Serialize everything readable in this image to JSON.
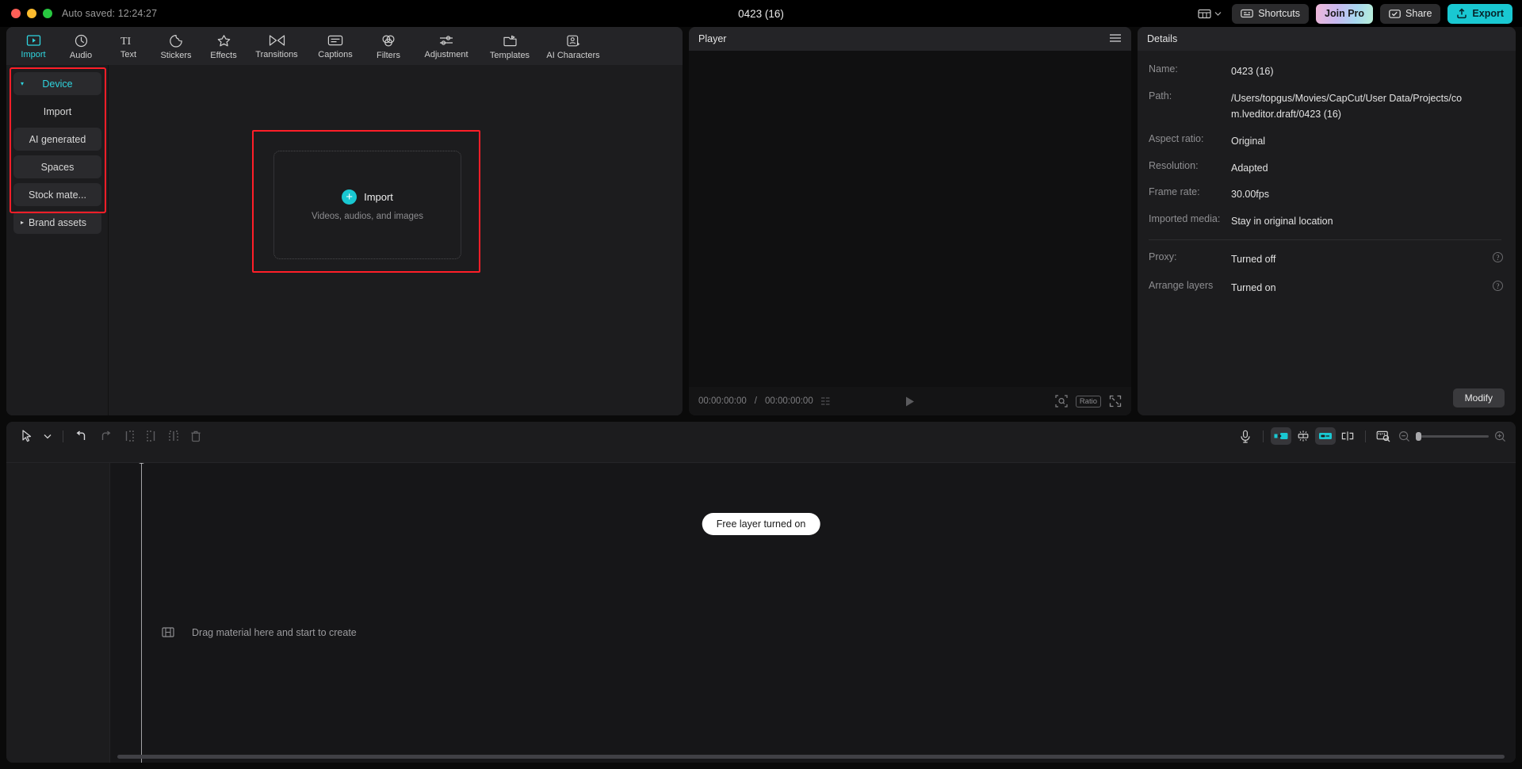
{
  "titlebar": {
    "autosave": "Auto saved: 12:24:27",
    "project_title": "0423 (16)",
    "layout_icon": "layout-icon",
    "chevron_icon": "chevron-down-icon",
    "buttons": [
      {
        "label": "Shortcuts",
        "icon": "keyboard-icon",
        "style": "default"
      },
      {
        "label": "Join Pro",
        "icon": "",
        "style": "join"
      },
      {
        "label": "Share",
        "icon": "share-icon",
        "style": "default"
      },
      {
        "label": "Export",
        "icon": "export-icon",
        "style": "export"
      }
    ]
  },
  "nav_tabs": [
    {
      "label": "Import",
      "icon": "media-play-icon",
      "active": true
    },
    {
      "label": "Audio",
      "icon": "audio-note-icon",
      "active": false
    },
    {
      "label": "Text",
      "icon": "text-ti-icon",
      "active": false
    },
    {
      "label": "Stickers",
      "icon": "sticker-icon",
      "active": false
    },
    {
      "label": "Effects",
      "icon": "effects-star-icon",
      "active": false
    },
    {
      "label": "Transitions",
      "icon": "transitions-icon",
      "active": false
    },
    {
      "label": "Captions",
      "icon": "captions-icon",
      "active": false
    },
    {
      "label": "Filters",
      "icon": "filters-icon",
      "active": false
    },
    {
      "label": "Adjustment",
      "icon": "adjustment-sliders-icon",
      "active": false
    },
    {
      "label": "Templates",
      "icon": "templates-folder-icon",
      "active": false
    },
    {
      "label": "AI Characters",
      "icon": "ai-character-icon",
      "active": false
    }
  ],
  "categories": [
    {
      "label": "Device",
      "active": true,
      "caret": "▾",
      "filled": true
    },
    {
      "label": "Import",
      "active": false,
      "caret": "",
      "filled": false
    },
    {
      "label": "AI generated",
      "active": false,
      "caret": "",
      "filled": true
    },
    {
      "label": "Spaces",
      "active": false,
      "caret": "",
      "filled": true
    },
    {
      "label": "Stock mate...",
      "active": false,
      "caret": "",
      "filled": true
    },
    {
      "label": "Brand assets",
      "active": false,
      "caret": "▸",
      "filled": true
    }
  ],
  "dropzone": {
    "label": "Import",
    "sublabel": "Videos, audios, and images",
    "plus_icon": "plus-circle-icon"
  },
  "player": {
    "title": "Player",
    "menu_icon": "hamburger-icon",
    "current_time": "00:00:00:00",
    "total_time": "00:00:00:00",
    "separator": "/",
    "play_icon": "play-icon",
    "frames_icon": "frames-icon",
    "zoom_icon": "zoom-fit-icon",
    "ratio_label": "Ratio",
    "fullscreen_icon": "fullscreen-icon"
  },
  "details": {
    "title": "Details",
    "rows": [
      {
        "label": "Name:",
        "value": "0423 (16)"
      },
      {
        "label": "Path:",
        "value": "/Users/topgus/Movies/CapCut/User Data/Projects/com.lveditor.draft/0423 (16)"
      },
      {
        "label": "Aspect ratio:",
        "value": "Original"
      },
      {
        "label": "Resolution:",
        "value": "Adapted"
      },
      {
        "label": "Frame rate:",
        "value": "30.00fps"
      },
      {
        "label": "Imported media:",
        "value": "Stay in original location"
      }
    ],
    "toggle_rows": [
      {
        "label": "Proxy:",
        "value": "Turned off",
        "help_icon": "help-circle-icon"
      },
      {
        "label": "Arrange layers",
        "value": "Turned on",
        "help_icon": "help-circle-icon"
      }
    ],
    "modify_label": "Modify"
  },
  "timeline": {
    "tools": [
      {
        "name": "select-cursor-tool",
        "icon": "cursor-arrow-icon",
        "dim": false
      },
      {
        "name": "tool-dropdown",
        "icon": "chevron-down-icon",
        "dim": false
      },
      {
        "name": "undo-button",
        "icon": "undo-icon",
        "dim": false
      },
      {
        "name": "redo-button",
        "icon": "redo-icon",
        "dim": true
      },
      {
        "name": "split-left-button",
        "icon": "split-left-icon",
        "dim": true
      },
      {
        "name": "split-right-button",
        "icon": "split-right-icon",
        "dim": true
      },
      {
        "name": "split-button",
        "icon": "split-icon",
        "dim": true
      },
      {
        "name": "delete-button",
        "icon": "trash-icon",
        "dim": true
      }
    ],
    "right_tools": [
      {
        "name": "record-voiceover-button",
        "icon": "microphone-icon",
        "on": false
      },
      {
        "name": "auto-snap-start-toggle",
        "icon": "snap-start-icon",
        "on": true
      },
      {
        "name": "magnet-snap-toggle",
        "icon": "magnet-icon",
        "on": false
      },
      {
        "name": "link-toggle",
        "icon": "link-icon",
        "on": true
      },
      {
        "name": "adjust-toggle",
        "icon": "adjust-icon",
        "on": false
      },
      {
        "name": "preview-scale-toggle",
        "icon": "ruler-preview-icon",
        "on": false
      }
    ],
    "zoom_out_icon": "zoom-out-icon",
    "zoom_in_icon": "zoom-in-icon",
    "toast": "Free layer turned on",
    "drag_hint": "Drag material here and start to create",
    "drag_hint_icon": "film-strip-icon"
  },
  "colors": {
    "accent": "#19c8d2",
    "accent_text": "#2fd4de",
    "highlight_box": "#ff1e28",
    "panel_bg": "#1c1c1e",
    "header_bg": "#242427"
  }
}
